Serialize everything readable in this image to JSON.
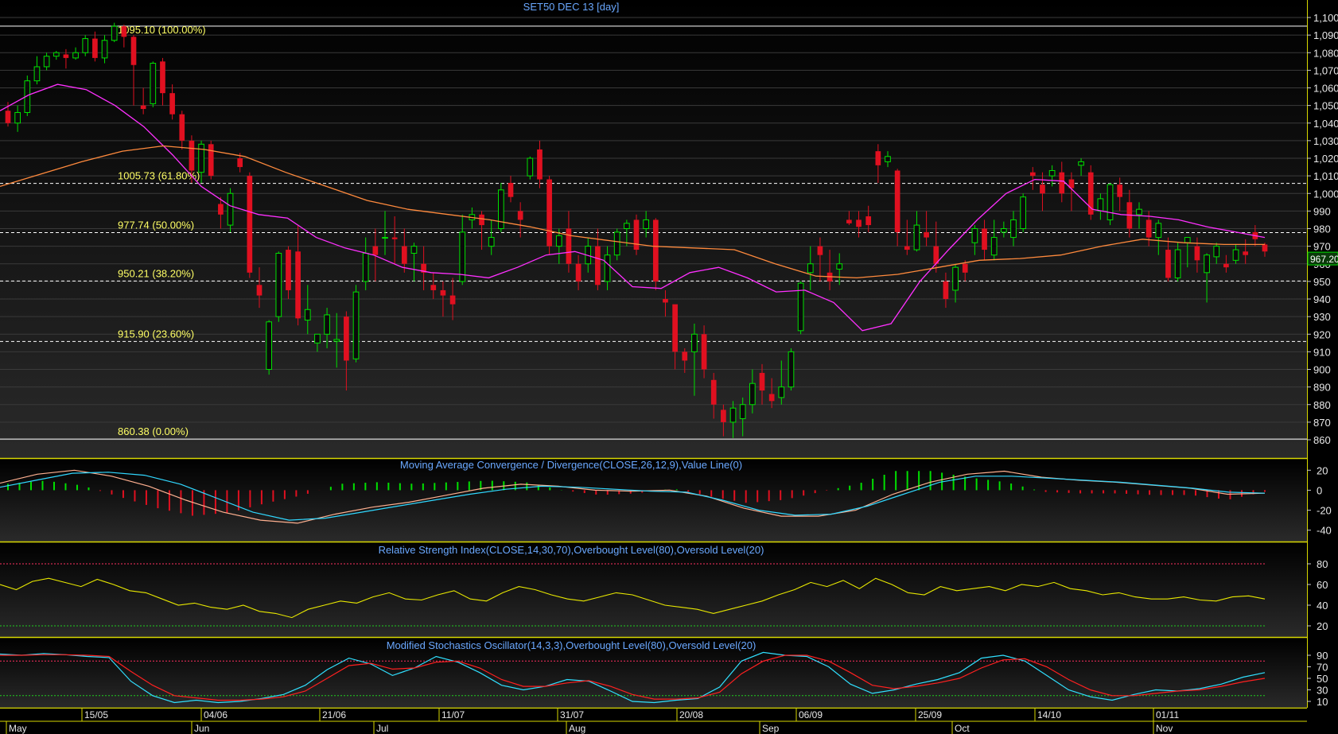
{
  "chart_title": "SET50 DEC 13   [day]",
  "last_price_label": "967.20",
  "colors": {
    "up": "#00e000",
    "down": "#e01020",
    "ma_short": "#ff30ff",
    "ma_long": "#ff8a3d",
    "fib": "#ffff66",
    "title": "#6aa8ff",
    "axis_text": "#e8e8e8",
    "macd_line": "#ffb090",
    "macd_signal": "#30d8ff",
    "rsi": "#e8e800",
    "stoch_k": "#30e0ff",
    "stoch_d": "#ff2020"
  },
  "price_axis": {
    "min": 860,
    "max": 1100,
    "ticks": [
      "1,100",
      "1,090",
      "1,080",
      "1,070",
      "1,060",
      "1,050",
      "1,040",
      "1,030",
      "1,020",
      "1,010",
      "1,000",
      "990",
      "980",
      "970",
      "960",
      "950",
      "940",
      "930",
      "920",
      "910",
      "900",
      "890",
      "880",
      "870",
      "860"
    ]
  },
  "fib_levels": [
    {
      "value": 1095.1,
      "label": "1095.10 (100.00%)",
      "style": "solid"
    },
    {
      "value": 1005.73,
      "label": "1005.73 (61.80%)",
      "style": "dashed"
    },
    {
      "value": 977.74,
      "label": "977.74 (50.00%)",
      "style": "dashed"
    },
    {
      "value": 950.21,
      "label": "950.21 (38.20%)",
      "style": "dashed"
    },
    {
      "value": 915.9,
      "label": "915.90 (23.60%)",
      "style": "dashed"
    },
    {
      "value": 860.38,
      "label": "860.38 (0.00%)",
      "style": "solid"
    }
  ],
  "indicators": {
    "macd_title": "Moving Average Convergence / Divergence(CLOSE,26,12,9),Value Line(0)",
    "macd_ticks": [
      "20",
      "0",
      "-20",
      "-40"
    ],
    "rsi_title": "Relative Strength Index(CLOSE,14,30,70),Overbought Level(80),Oversold Level(20)",
    "rsi_ticks": [
      "80",
      "60",
      "40",
      "20"
    ],
    "stoch_title": "Modified Stochastics Oscillator(14,3,3),Overbought Level(80),Oversold Level(20)",
    "stoch_ticks": [
      "90",
      "70",
      "50",
      "30",
      "10"
    ]
  },
  "date_axis": {
    "days": [
      "15/05",
      "04/06",
      "21/06",
      "11/07",
      "31/07",
      "20/08",
      "06/09",
      "25/09",
      "14/10",
      "01/11"
    ],
    "months": [
      "May",
      "Jun",
      "Jul",
      "Aug",
      "Sep",
      "Oct",
      "Nov"
    ]
  },
  "chart_data": {
    "type": "candlestick",
    "title": "SET50 DEC 13   [day]",
    "ylim": [
      860,
      1100
    ],
    "candles": [
      [
        1047,
        1052,
        1038,
        1040
      ],
      [
        1040,
        1050,
        1035,
        1046
      ],
      [
        1046,
        1067,
        1044,
        1064
      ],
      [
        1064,
        1078,
        1062,
        1072
      ],
      [
        1072,
        1080,
        1070,
        1078
      ],
      [
        1078,
        1081,
        1076,
        1080
      ],
      [
        1079,
        1082,
        1071,
        1077
      ],
      [
        1077,
        1083,
        1076,
        1080
      ],
      [
        1080,
        1090,
        1078,
        1088
      ],
      [
        1088,
        1092,
        1075,
        1077
      ],
      [
        1077,
        1090,
        1074,
        1087
      ],
      [
        1087,
        1097,
        1086,
        1095
      ],
      [
        1095,
        1096,
        1083,
        1089
      ],
      [
        1089,
        1090,
        1050,
        1073
      ],
      [
        1050,
        1060,
        1045,
        1048
      ],
      [
        1051,
        1075,
        1049,
        1074
      ],
      [
        1075,
        1077,
        1050,
        1057
      ],
      [
        1057,
        1062,
        1042,
        1045
      ],
      [
        1045,
        1047,
        1025,
        1030
      ],
      [
        1030,
        1033,
        1006,
        1013
      ],
      [
        1012,
        1030,
        1006,
        1028
      ],
      [
        1028,
        1030,
        1008,
        1010
      ],
      [
        994,
        998,
        980,
        988
      ],
      [
        982,
        1003,
        978,
        1000
      ],
      [
        1020,
        1023,
        1012,
        1015
      ],
      [
        1010,
        1012,
        952,
        955
      ],
      [
        948,
        958,
        935,
        942
      ],
      [
        900,
        928,
        897,
        927
      ],
      [
        930,
        967,
        927,
        966
      ],
      [
        968,
        970,
        940,
        945
      ],
      [
        967,
        982,
        925,
        929
      ],
      [
        928,
        948,
        920,
        934
      ],
      [
        915,
        920,
        910,
        920
      ],
      [
        920,
        935,
        912,
        931
      ],
      [
        916,
        932,
        901,
        917
      ],
      [
        930,
        933,
        888,
        905
      ],
      [
        906,
        948,
        904,
        944
      ],
      [
        950,
        975,
        945,
        966
      ],
      [
        970,
        980,
        950,
        965
      ],
      [
        975,
        990,
        965,
        975
      ],
      [
        975,
        987,
        960,
        974
      ],
      [
        970,
        980,
        955,
        960
      ],
      [
        966,
        972,
        950,
        970
      ],
      [
        960,
        970,
        945,
        955
      ],
      [
        948,
        955,
        940,
        945
      ],
      [
        945,
        950,
        930,
        942
      ],
      [
        942,
        952,
        928,
        937
      ],
      [
        950,
        988,
        948,
        978
      ],
      [
        985,
        992,
        980,
        988
      ],
      [
        988,
        990,
        968,
        982
      ],
      [
        970,
        985,
        965,
        975
      ],
      [
        980,
        1006,
        978,
        1002
      ],
      [
        1006,
        1010,
        995,
        998
      ],
      [
        990,
        995,
        975,
        985
      ],
      [
        1010,
        1021,
        1008,
        1020
      ],
      [
        1025,
        1030,
        1003,
        1008
      ],
      [
        1008,
        1010,
        965,
        970
      ],
      [
        970,
        980,
        960,
        976
      ],
      [
        980,
        990,
        955,
        960
      ],
      [
        960,
        965,
        945,
        950
      ],
      [
        960,
        975,
        955,
        970
      ],
      [
        970,
        980,
        945,
        948
      ],
      [
        950,
        970,
        945,
        965
      ],
      [
        965,
        980,
        962,
        978
      ],
      [
        980,
        985,
        970,
        983
      ],
      [
        985,
        988,
        965,
        968
      ],
      [
        980,
        990,
        975,
        985
      ],
      [
        985,
        986,
        945,
        950
      ],
      [
        940,
        945,
        930,
        938
      ],
      [
        937,
        935,
        900,
        910
      ],
      [
        910,
        912,
        898,
        905
      ],
      [
        910,
        926,
        885,
        920
      ],
      [
        920,
        925,
        895,
        900
      ],
      [
        894,
        898,
        872,
        880
      ],
      [
        877,
        880,
        862,
        870
      ],
      [
        870,
        882,
        861,
        878
      ],
      [
        872,
        884,
        862,
        880
      ],
      [
        880,
        900,
        875,
        892
      ],
      [
        898,
        903,
        880,
        888
      ],
      [
        886,
        895,
        878,
        882
      ],
      [
        884,
        905,
        880,
        890
      ],
      [
        890,
        912,
        888,
        910
      ],
      [
        922,
        950,
        920,
        949
      ],
      [
        955,
        970,
        945,
        960
      ],
      [
        970,
        975,
        950,
        965
      ],
      [
        955,
        968,
        945,
        950
      ],
      [
        957,
        966,
        948,
        960
      ],
      [
        985,
        990,
        982,
        983
      ],
      [
        985,
        990,
        975,
        981
      ],
      [
        987,
        993,
        978,
        982
      ],
      [
        1024,
        1028,
        1006,
        1016
      ],
      [
        1018,
        1024,
        1015,
        1021
      ],
      [
        1013,
        1014,
        970,
        978
      ],
      [
        970,
        985,
        965,
        968
      ],
      [
        968,
        990,
        967,
        982
      ],
      [
        978,
        990,
        970,
        975
      ],
      [
        970,
        984,
        955,
        960
      ],
      [
        950,
        955,
        935,
        940
      ],
      [
        945,
        960,
        938,
        958
      ],
      [
        960,
        962,
        950,
        955
      ],
      [
        972,
        982,
        965,
        980
      ],
      [
        980,
        985,
        962,
        968
      ],
      [
        965,
        985,
        962,
        975
      ],
      [
        978,
        984,
        975,
        980
      ],
      [
        975,
        990,
        970,
        985
      ],
      [
        980,
        1000,
        978,
        998
      ],
      [
        1012,
        1015,
        1002,
        1010
      ],
      [
        1005,
        1012,
        990,
        1000
      ],
      [
        1010,
        1016,
        1004,
        1013
      ],
      [
        1012,
        1018,
        995,
        1000
      ],
      [
        1008,
        1012,
        990,
        1003
      ],
      [
        1016,
        1020,
        1010,
        1018
      ],
      [
        1012,
        1016,
        985,
        988
      ],
      [
        990,
        1000,
        985,
        997
      ],
      [
        985,
        1006,
        982,
        1005
      ],
      [
        1005,
        1009,
        990,
        998
      ],
      [
        995,
        1002,
        975,
        980
      ],
      [
        988,
        995,
        980,
        991
      ],
      [
        985,
        990,
        970,
        975
      ],
      [
        975,
        985,
        965,
        983
      ],
      [
        968,
        975,
        950,
        952
      ],
      [
        952,
        972,
        950,
        968
      ],
      [
        972,
        975,
        958,
        975
      ],
      [
        970,
        975,
        955,
        962
      ],
      [
        955,
        966,
        938,
        965
      ],
      [
        964,
        972,
        960,
        970
      ],
      [
        960,
        965,
        955,
        958
      ],
      [
        962,
        971,
        960,
        968
      ],
      [
        967,
        974,
        960,
        965
      ],
      [
        978,
        982,
        970,
        974
      ],
      [
        971,
        972,
        964,
        967
      ]
    ],
    "ma_short": [
      1047,
      1056,
      1062,
      1059,
      1050,
      1038,
      1022,
      1004,
      993,
      988,
      986,
      975,
      969,
      965,
      958,
      955,
      954,
      952,
      958,
      965,
      967,
      962,
      947,
      946,
      955,
      958,
      952,
      944,
      945,
      938,
      922,
      926,
      950,
      968,
      985,
      1000,
      1008,
      1007,
      991,
      988,
      987,
      985,
      981,
      978,
      975
    ],
    "ma_long": [
      1004,
      1011,
      1018,
      1024,
      1027,
      1025,
      1021,
      1012,
      1004,
      996,
      991,
      988,
      985,
      981,
      976,
      973,
      970,
      969,
      968,
      960,
      953,
      952,
      954,
      958,
      962,
      963,
      965,
      970,
      974,
      972,
      971,
      971
    ],
    "macd": {
      "macd_line": [
        7,
        16,
        20,
        14,
        4,
        -10,
        -22,
        -30,
        -33,
        -24,
        -17,
        -12,
        -5,
        2,
        6,
        4,
        0,
        -1,
        0,
        -6,
        -18,
        -26,
        -26,
        -20,
        -4,
        8,
        16,
        19,
        13,
        10,
        8,
        5,
        2,
        -4,
        -3
      ],
      "signal_line": [
        3,
        10,
        17,
        18,
        15,
        6,
        -8,
        -22,
        -30,
        -28,
        -22,
        -16,
        -10,
        -4,
        1,
        4,
        3,
        1,
        -1,
        -2,
        -10,
        -20,
        -25,
        -24,
        -16,
        -4,
        8,
        14,
        14,
        12,
        10,
        8,
        5,
        2,
        -2,
        -3
      ],
      "ticks": [
        20,
        0,
        -20,
        -40
      ]
    },
    "rsi": {
      "values": [
        60,
        55,
        63,
        66,
        62,
        58,
        65,
        60,
        54,
        52,
        46,
        40,
        42,
        38,
        36,
        40,
        34,
        32,
        28,
        36,
        40,
        44,
        42,
        48,
        52,
        46,
        45,
        50,
        54,
        46,
        44,
        52,
        58,
        55,
        50,
        46,
        44,
        48,
        52,
        50,
        45,
        40,
        38,
        36,
        32,
        36,
        40,
        44,
        50,
        55,
        62,
        58,
        64,
        56,
        66,
        60,
        52,
        50,
        58,
        54,
        56,
        58,
        54,
        60,
        58,
        62,
        56,
        54,
        50,
        52,
        48,
        46,
        46,
        48,
        45,
        44,
        48,
        49,
        46
      ],
      "overbought": 80,
      "oversold": 20
    },
    "stoch": {
      "k": [
        92,
        90,
        93,
        91,
        88,
        86,
        45,
        20,
        8,
        12,
        8,
        10,
        15,
        22,
        38,
        65,
        85,
        75,
        55,
        68,
        88,
        78,
        60,
        38,
        30,
        36,
        48,
        45,
        28,
        10,
        8,
        12,
        15,
        35,
        80,
        95,
        90,
        88,
        70,
        40,
        24,
        30,
        40,
        48,
        60,
        85,
        90,
        80,
        55,
        30,
        18,
        12,
        22,
        30,
        28,
        32,
        40,
        52,
        60
      ],
      "d": [
        90,
        90,
        91,
        91,
        90,
        88,
        62,
        38,
        20,
        16,
        12,
        12,
        14,
        18,
        28,
        50,
        72,
        76,
        66,
        68,
        78,
        80,
        68,
        48,
        36,
        36,
        42,
        46,
        36,
        22,
        14,
        14,
        16,
        26,
        58,
        80,
        90,
        90,
        80,
        60,
        38,
        32,
        36,
        42,
        50,
        68,
        82,
        84,
        70,
        48,
        30,
        20,
        20,
        24,
        28,
        30,
        36,
        44,
        50
      ],
      "overbought": 80,
      "oversold": 20
    }
  }
}
